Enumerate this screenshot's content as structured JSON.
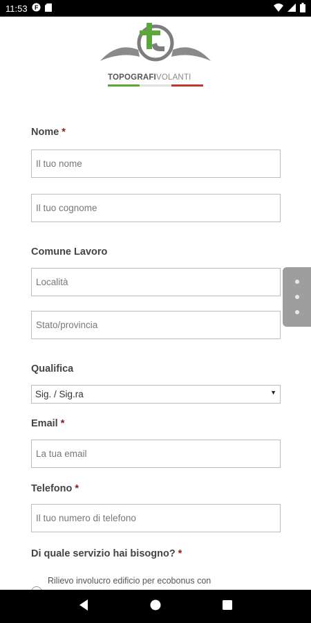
{
  "status_bar": {
    "time": "11:53",
    "left_icons": [
      "notification-f-icon",
      "sd-card-icon"
    ],
    "right_icons": [
      "wifi-icon",
      "signal-icon",
      "battery-icon"
    ]
  },
  "logo": {
    "text_bold": "TOPOGRAFI",
    "text_light": "VOLANTI",
    "colors": {
      "green": "#5aa83a",
      "gray": "#7d7d7d",
      "red": "#c0392b"
    }
  },
  "form": {
    "nome": {
      "label": "Nome",
      "required": "*",
      "first_placeholder": "Il tuo nome",
      "last_placeholder": "Il tuo cognome"
    },
    "comune": {
      "label": "Comune Lavoro",
      "city_placeholder": "Località",
      "state_placeholder": "Stato/provincia"
    },
    "qualifica": {
      "label": "Qualifica",
      "selected": "Sig. / Sig.ra"
    },
    "email": {
      "label": "Email",
      "required": "*",
      "placeholder": "La tua email"
    },
    "telefono": {
      "label": "Telefono",
      "required": "*",
      "placeholder": "Il tuo numero di telefono"
    },
    "servizio": {
      "label": "Di quale servizio hai bisogno?",
      "required": "*",
      "options": [
        "Rilievo involucro edificio per ecobonus con"
      ]
    }
  },
  "side_handle": {
    "icon": "more-vertical-icon"
  },
  "nav_bar": {
    "icons": [
      "back-icon",
      "home-icon",
      "recents-icon"
    ]
  },
  "accent": "#8b1a1a"
}
